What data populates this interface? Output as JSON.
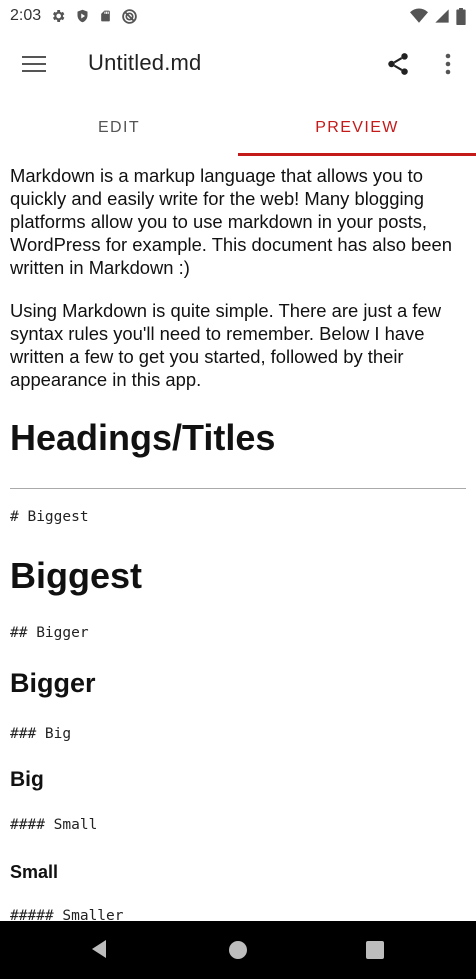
{
  "status_bar": {
    "time": "2:03",
    "icons": [
      "settings-icon",
      "shield-icon",
      "sd-card-icon",
      "do-not-disturb-icon",
      "wifi-icon",
      "signal-icon",
      "battery-icon"
    ]
  },
  "app_bar": {
    "title": "Untitled.md",
    "menu_icon": "hamburger-menu-icon",
    "share_icon": "share-icon",
    "more_icon": "more-vertical-icon"
  },
  "tabs": [
    {
      "label": "EDIT",
      "selected": false
    },
    {
      "label": "PREVIEW",
      "selected": true
    }
  ],
  "preview": {
    "paragraph1": "Markdown is a markup language that allows you to quickly and easily write for the web! Many blogging platforms allow you to use markdown in your posts, WordPress for example. This document has also been written in Markdown :)",
    "paragraph2": "Using Markdown is quite simple. There are just a few syntax rules you'll need to remember. Below I have written a few to get you started, followed by their appearance in this app.",
    "section_title": "Headings/Titles",
    "code1": "# Biggest",
    "heading1": "Biggest",
    "code2": "## Bigger",
    "heading2": "Bigger",
    "code3": "### Big",
    "heading3": "Big",
    "code4": "#### Small",
    "heading4": "Small",
    "code5": "##### Smaller"
  },
  "colors": {
    "accent": "#c41a1a",
    "nav_bar": "#000000",
    "divider": "#aaaaaa"
  }
}
